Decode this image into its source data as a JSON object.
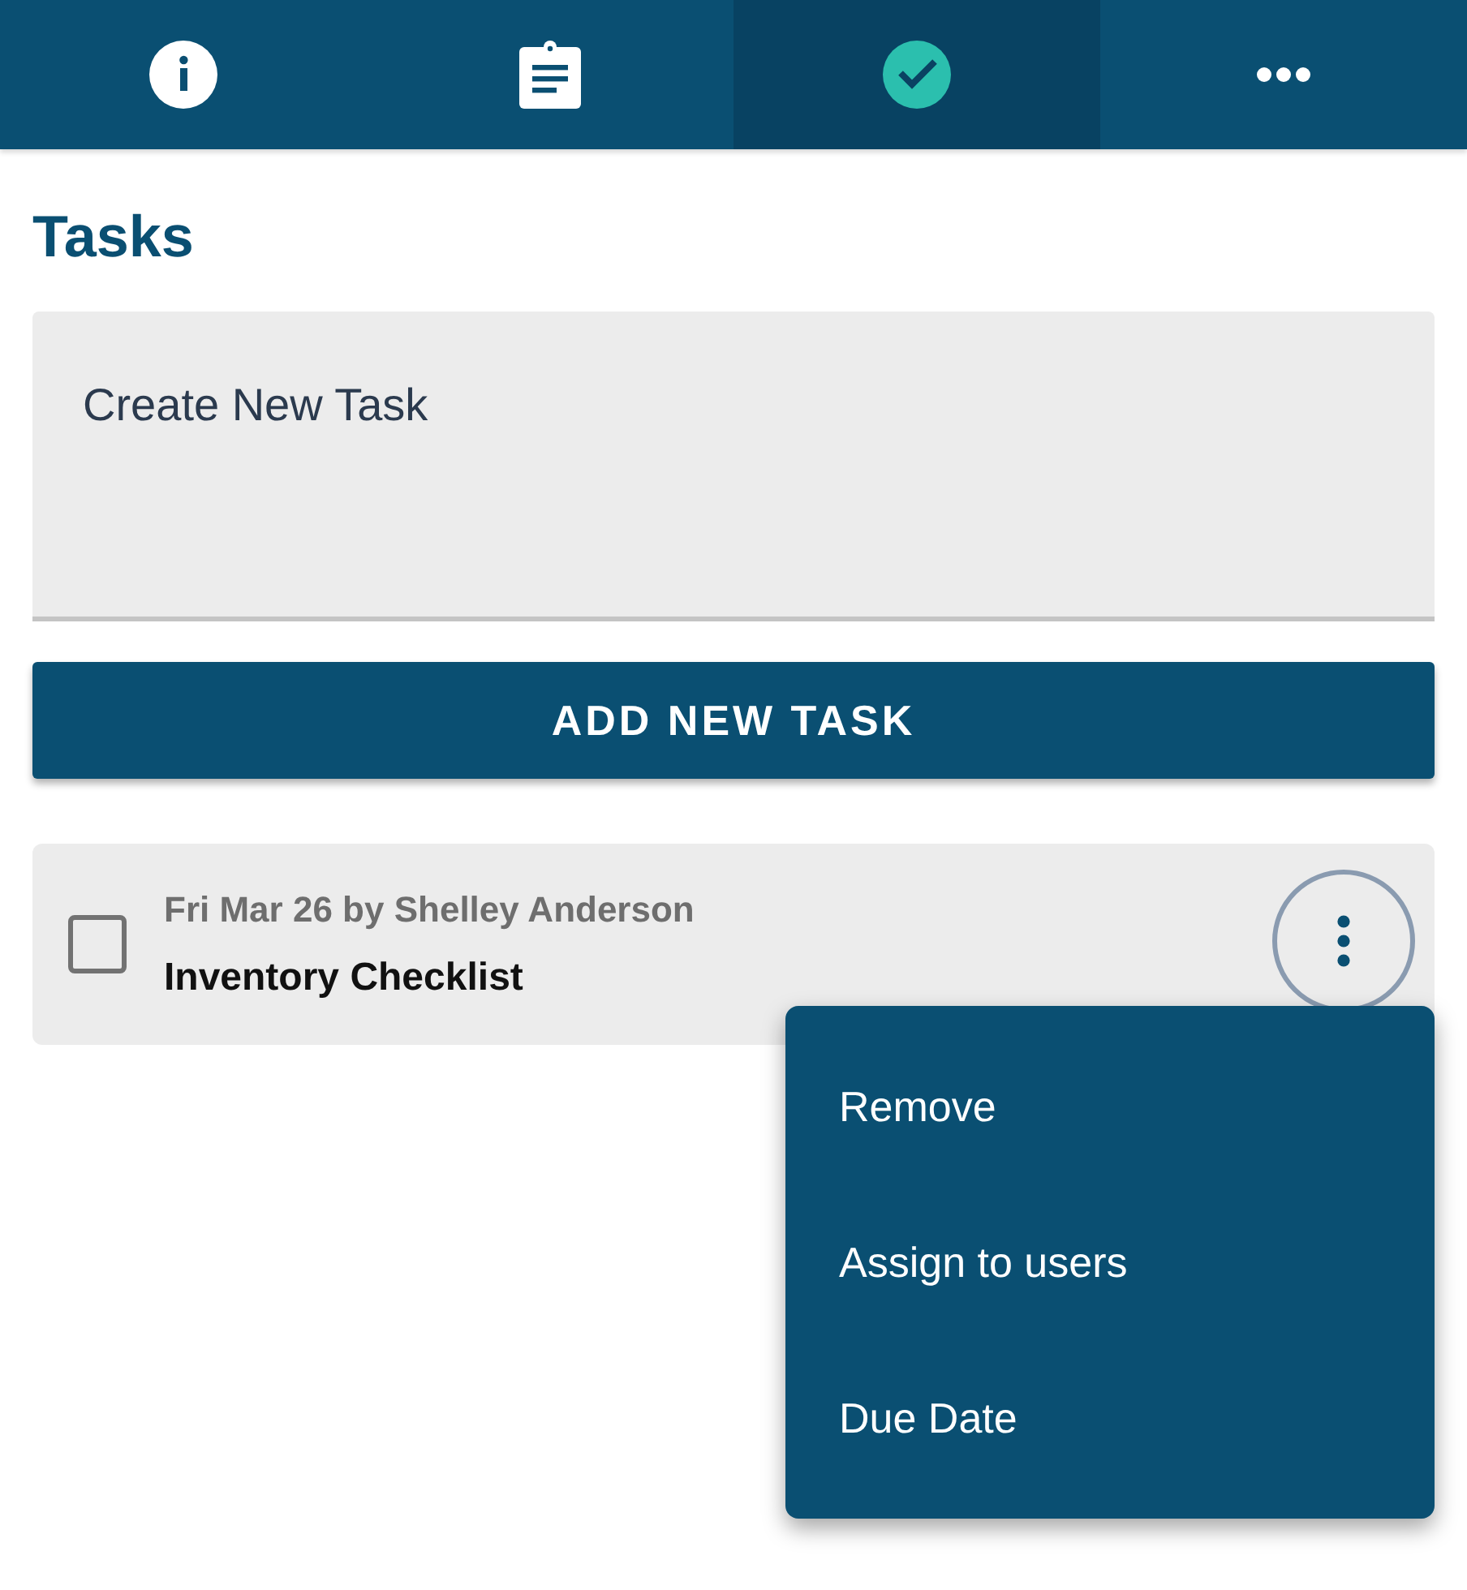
{
  "tabs": [
    {
      "kind": "info",
      "selected": false
    },
    {
      "kind": "clipboard",
      "selected": false
    },
    {
      "kind": "check",
      "selected": true
    },
    {
      "kind": "more",
      "selected": false
    }
  ],
  "title": "Tasks",
  "new_task": {
    "placeholder": "Create New Task"
  },
  "add_button": "ADD NEW TASK",
  "tasks": [
    {
      "checked": false,
      "meta": "Fri Mar 26 by **Shelley Anderson**",
      "name": "Inventory Checklist",
      "menu_open": true
    }
  ],
  "menu": {
    "items": [
      "Remove",
      "Assign to users",
      "Due Date"
    ]
  }
}
